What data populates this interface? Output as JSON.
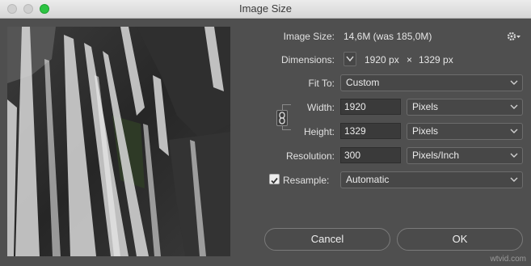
{
  "window": {
    "title": "Image Size"
  },
  "info": {
    "image_size_label": "Image Size:",
    "image_size_value": "14,6M (was 185,0M)",
    "dimensions_label": "Dimensions:",
    "dim_width": "1920 px",
    "dim_x": "×",
    "dim_height": "1329 px"
  },
  "fit_to": {
    "label": "Fit To:",
    "value": "Custom"
  },
  "width": {
    "label": "Width:",
    "value": "1920",
    "unit": "Pixels"
  },
  "height": {
    "label": "Height:",
    "value": "1329",
    "unit": "Pixels"
  },
  "resolution": {
    "label": "Resolution:",
    "value": "300",
    "unit": "Pixels/Inch"
  },
  "resample": {
    "label": "Resample:",
    "checked": true,
    "value": "Automatic"
  },
  "buttons": {
    "cancel": "Cancel",
    "ok": "OK"
  },
  "watermark": "wtvid.com",
  "icons": {
    "settings": "gear-icon",
    "dimensions_menu": "chevron-down-icon",
    "constrain": "link-icon"
  }
}
